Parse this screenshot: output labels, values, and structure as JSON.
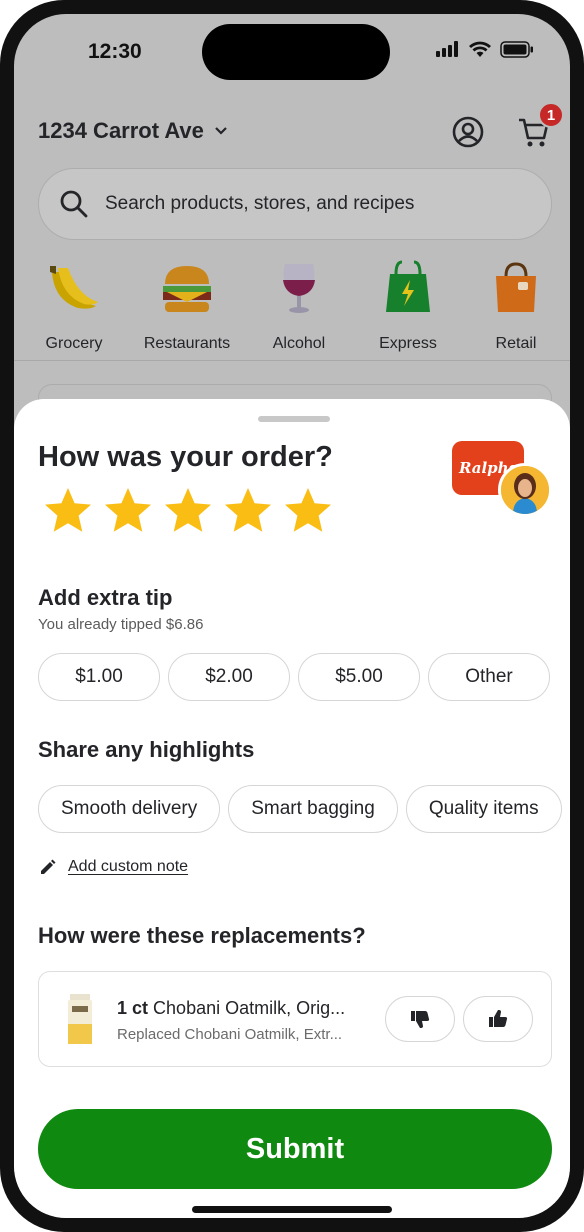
{
  "status_bar": {
    "time": "12:30"
  },
  "header": {
    "address": "1234 Carrot Ave",
    "cart_count": "1"
  },
  "search": {
    "placeholder": "Search products, stores, and recipes"
  },
  "categories": [
    {
      "label": "Grocery",
      "icon": "banana-icon"
    },
    {
      "label": "Restaurants",
      "icon": "burger-icon"
    },
    {
      "label": "Alcohol",
      "icon": "wine-glass-icon"
    },
    {
      "label": "Express",
      "icon": "express-bag-icon"
    },
    {
      "label": "Retail",
      "icon": "shopping-bag-icon"
    }
  ],
  "sheet": {
    "title": "How was your order?",
    "store_logo_text": "Ralphs",
    "rating_stars": 5,
    "tip": {
      "title": "Add extra tip",
      "subtitle": "You already tipped $6.86",
      "options": [
        "$1.00",
        "$2.00",
        "$5.00",
        "Other"
      ]
    },
    "highlights": {
      "title": "Share any highlights",
      "options": [
        "Smooth delivery",
        "Smart bagging",
        "Quality items"
      ]
    },
    "custom_note_label": "Add custom note",
    "replacements": {
      "title": "How were these replacements?",
      "item_qty": "1 ct",
      "item_name": "Chobani Oatmilk, Orig...",
      "item_sub": "Replaced Chobani Oatmilk, Extr..."
    },
    "submit_label": "Submit"
  },
  "colors": {
    "accent_green": "#108910",
    "star_yellow": "#F9BD14",
    "badge_red": "#C62828",
    "store_red": "#E2411C"
  }
}
